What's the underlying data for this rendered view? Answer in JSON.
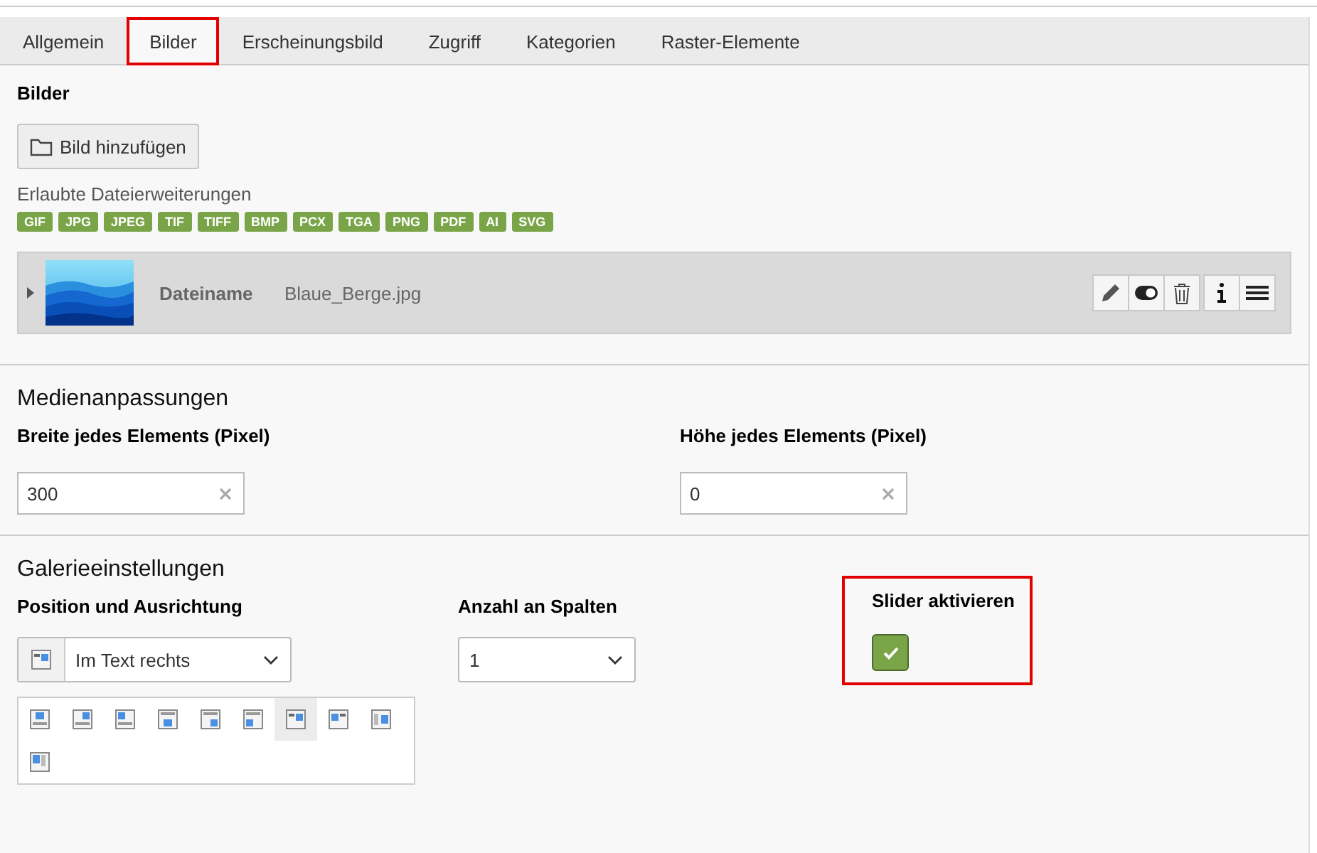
{
  "tabs": [
    {
      "label": "Allgemein",
      "selected": false,
      "highlighted": false
    },
    {
      "label": "Bilder",
      "selected": true,
      "highlighted": true
    },
    {
      "label": "Erscheinungsbild",
      "selected": false,
      "highlighted": false
    },
    {
      "label": "Zugriff",
      "selected": false,
      "highlighted": false
    },
    {
      "label": "Kategorien",
      "selected": false,
      "highlighted": false
    },
    {
      "label": "Raster-Elemente",
      "selected": false,
      "highlighted": false
    }
  ],
  "images": {
    "title": "Bilder",
    "add_button": "Bild hinzufügen",
    "allowed_label": "Erlaubte Dateierweiterungen",
    "extensions": [
      "GIF",
      "JPG",
      "JPEG",
      "TIF",
      "TIFF",
      "BMP",
      "PCX",
      "TGA",
      "PNG",
      "PDF",
      "AI",
      "SVG"
    ],
    "file": {
      "label": "Dateiname",
      "name": "Blaue_Berge.jpg",
      "toggle_on": true
    }
  },
  "media": {
    "title": "Medienanpassungen",
    "fields": [
      {
        "label": "Breite jedes Elements (Pixel)",
        "value": "300"
      },
      {
        "label": "Höhe jedes Elements (Pixel)",
        "value": "0"
      }
    ]
  },
  "gallery": {
    "title": "Galerieeinstellungen",
    "position": {
      "label": "Position und Ausrichtung",
      "value": "Im Text rechts",
      "options": [
        {
          "kind": "above-center",
          "selected": false
        },
        {
          "kind": "above-right",
          "selected": false
        },
        {
          "kind": "above-left",
          "selected": false
        },
        {
          "kind": "below-center",
          "selected": false
        },
        {
          "kind": "below-right",
          "selected": false
        },
        {
          "kind": "below-left",
          "selected": false
        },
        {
          "kind": "intext-right",
          "selected": true
        },
        {
          "kind": "intext-left",
          "selected": false
        },
        {
          "kind": "beside-right",
          "selected": false
        },
        {
          "kind": "beside-left",
          "selected": false
        }
      ]
    },
    "columns": {
      "label": "Anzahl an Spalten",
      "value": "1"
    },
    "slider": {
      "label": "Slider aktivieren",
      "checked": true,
      "highlighted": true
    }
  }
}
